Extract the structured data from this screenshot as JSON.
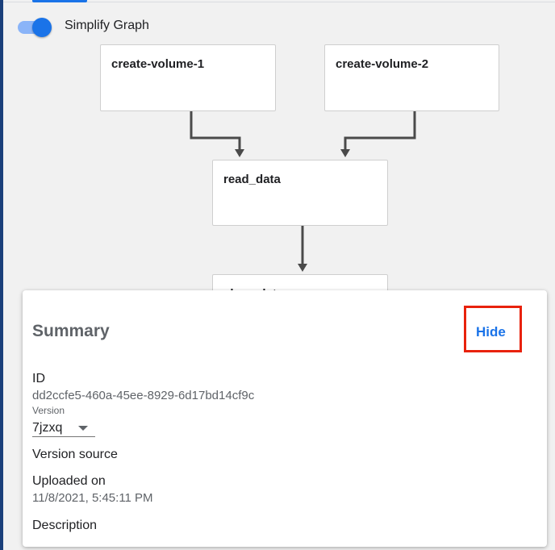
{
  "toggle": {
    "label": "Simplify Graph",
    "checked": true
  },
  "graph": {
    "nodes": [
      "create-volume-1",
      "create-volume-2",
      "read_data",
      "show-data"
    ]
  },
  "summary": {
    "title": "Summary",
    "hide_label": "Hide",
    "id_label": "ID",
    "id_value": "dd2ccfe5-460a-45ee-8929-6d17bd14cf9c",
    "version_label": "Version",
    "version_value": "7jzxq",
    "version_source_label": "Version source",
    "uploaded_on_label": "Uploaded on",
    "uploaded_on_value": "11/8/2021, 5:45:11 PM",
    "description_label": "Description"
  },
  "colors": {
    "accent": "#1a73e8",
    "highlight": "#e8220c",
    "edge": "#4a4a4a"
  }
}
